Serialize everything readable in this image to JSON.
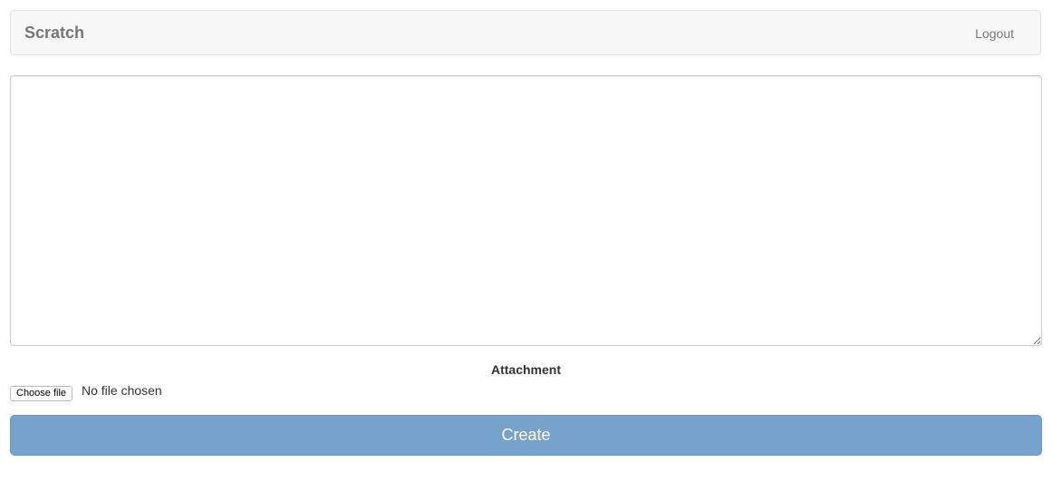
{
  "navbar": {
    "brand": "Scratch",
    "logout_label": "Logout"
  },
  "editor": {
    "value": "",
    "placeholder": ""
  },
  "attachment": {
    "label": "Attachment",
    "choose_label": "Choose file",
    "status": "No file chosen"
  },
  "create_label": "Create",
  "colors": {
    "create_button": "#77a2cb",
    "navbar_bg": "#f7f7f7"
  }
}
